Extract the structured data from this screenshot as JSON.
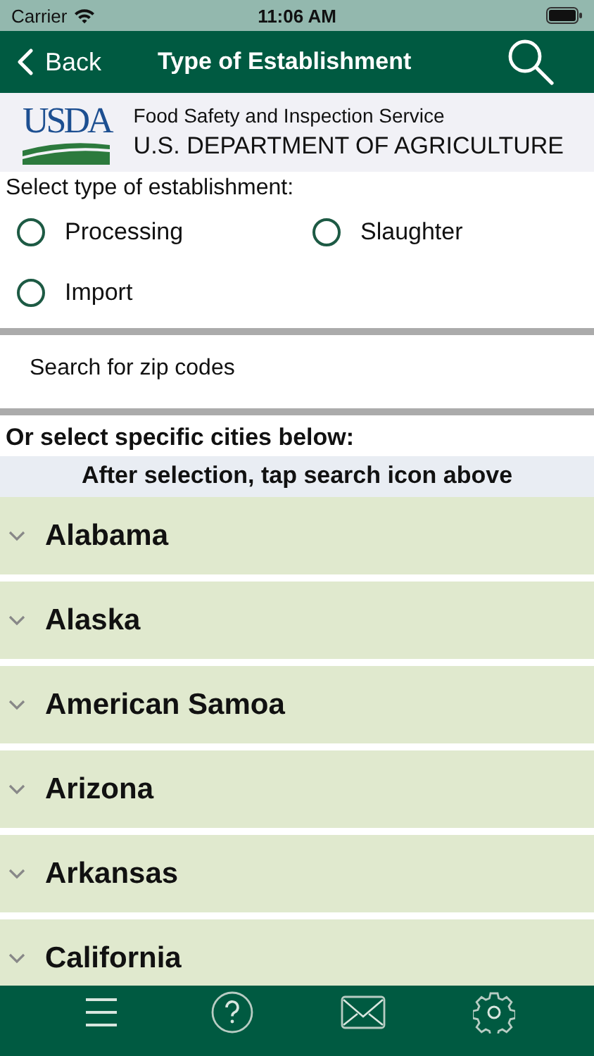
{
  "status_bar": {
    "carrier": "Carrier",
    "time": "11:06 AM"
  },
  "nav_bar": {
    "back": "Back",
    "title": "Type of Establishment"
  },
  "banner": {
    "logo": "USDA",
    "agency": "Food Safety and Inspection Service",
    "department": "U.S. DEPARTMENT OF AGRICULTURE"
  },
  "establishment_types": {
    "label": "Select type of establishment:",
    "options": [
      {
        "label": "Processing",
        "selected": false
      },
      {
        "label": "Slaughter",
        "selected": false
      },
      {
        "label": "Import",
        "selected": false
      }
    ]
  },
  "zip_search": {
    "placeholder": "Search for zip codes"
  },
  "cities_label": "Or select specific cities below:",
  "hint": "After selection, tap search icon above",
  "states": [
    {
      "name": "Alabama",
      "expanded": false
    },
    {
      "name": "Alaska",
      "expanded": false
    },
    {
      "name": "American Samoa",
      "expanded": false
    },
    {
      "name": "Arizona",
      "expanded": false
    },
    {
      "name": "Arkansas",
      "expanded": false
    },
    {
      "name": "California",
      "expanded": false
    }
  ],
  "tab_bar": [
    {
      "kind": "menu"
    },
    {
      "kind": "help"
    },
    {
      "kind": "mail"
    },
    {
      "kind": "settings"
    }
  ]
}
